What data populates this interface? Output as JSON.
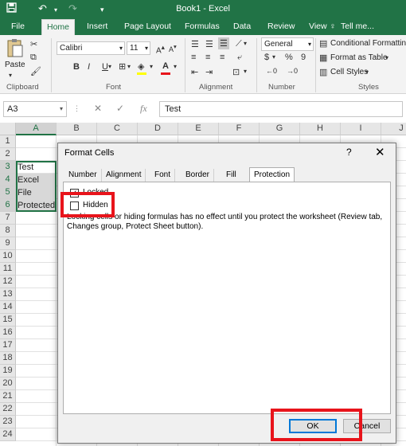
{
  "titlebar": {
    "title": "Book1 - Excel",
    "save_icon": "save-icon",
    "undo_icon": "undo-icon",
    "redo_icon": "redo-icon"
  },
  "ribbon_tabs": [
    {
      "label": "File"
    },
    {
      "label": "Home"
    },
    {
      "label": "Insert"
    },
    {
      "label": "Page Layout"
    },
    {
      "label": "Formulas"
    },
    {
      "label": "Data"
    },
    {
      "label": "Review"
    },
    {
      "label": "View"
    },
    {
      "label": "Tell me..."
    }
  ],
  "ribbon": {
    "clipboard": {
      "paste_label": "Paste",
      "group_label": "Clipboard"
    },
    "font": {
      "name": "Calibri",
      "size": "11",
      "bold": "B",
      "italic": "I",
      "underline": "U",
      "group_label": "Font",
      "font_color": "#e8141b",
      "highlight_color": "#ffff00"
    },
    "alignment": {
      "group_label": "Alignment"
    },
    "number": {
      "format": "General",
      "currency": "$",
      "percent": "%",
      "comma": "9",
      "group_label": "Number"
    },
    "styles": {
      "conditional": "Conditional Formatting",
      "format_table": "Format as Table",
      "cell_styles": "Cell Styles",
      "group_label": "Styles"
    }
  },
  "formula_bar": {
    "name_box": "A3",
    "fx": "fx",
    "value": "Test"
  },
  "sheet": {
    "columns": [
      "A",
      "B",
      "C",
      "D",
      "E",
      "F",
      "G",
      "H",
      "I",
      "J"
    ],
    "rows": [
      "1",
      "2",
      "3",
      "4",
      "5",
      "6",
      "7",
      "8",
      "9",
      "10",
      "11",
      "12",
      "13",
      "14",
      "15",
      "16",
      "17",
      "18",
      "19",
      "20",
      "21",
      "22",
      "23",
      "24"
    ],
    "cells": {
      "A3": "Test",
      "A4": "Excel",
      "A5": "File",
      "A6": "Protected"
    }
  },
  "dialog": {
    "title": "Format Cells",
    "help": "?",
    "close": "✕",
    "tabs": [
      "Number",
      "Alignment",
      "Font",
      "Border",
      "Fill",
      "Protection"
    ],
    "active_tab": "Protection",
    "locked_label": "Locked",
    "locked_checked": "✓",
    "hidden_label": "Hidden",
    "note_line1": "Locking cells or hiding formulas has no effect until you protect the worksheet (Review tab,",
    "note_line2": "Changes group, Protect Sheet button).",
    "ok_label": "OK",
    "cancel_label": "Cancel"
  },
  "colors": {
    "accent": "#217346",
    "highlight_box": "#e8141b",
    "selected_cells": "#d8d8d8"
  }
}
